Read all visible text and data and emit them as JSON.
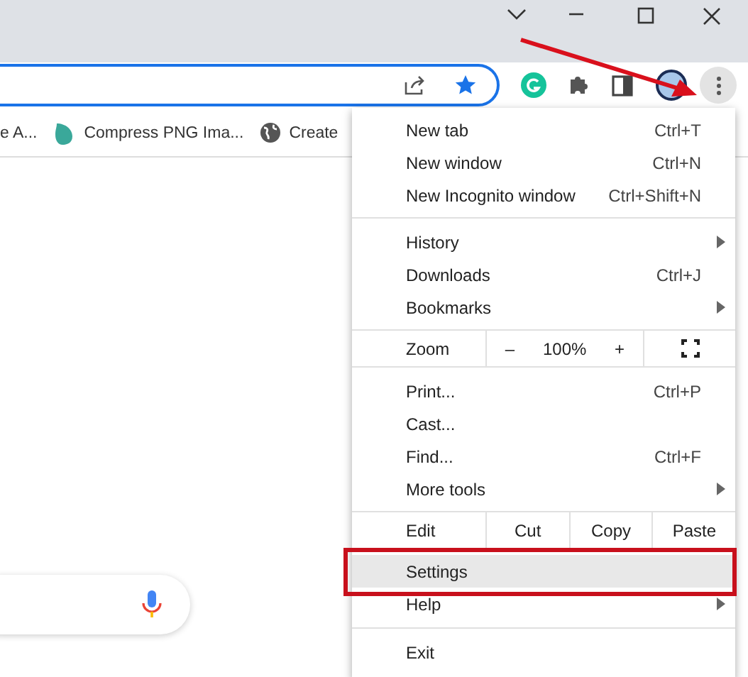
{
  "bookmarks": [
    {
      "label": "e A..."
    },
    {
      "label": "Compress PNG Ima..."
    },
    {
      "label": "Create"
    }
  ],
  "menu": {
    "sections": [
      {
        "items": [
          {
            "kind": "item",
            "label": "New tab",
            "shortcut": "Ctrl+T",
            "submenu": false,
            "selected": false
          },
          {
            "kind": "item",
            "label": "New window",
            "shortcut": "Ctrl+N",
            "submenu": false,
            "selected": false
          },
          {
            "kind": "item",
            "label": "New Incognito window",
            "shortcut": "Ctrl+Shift+N",
            "submenu": false,
            "selected": false
          }
        ]
      },
      {
        "items": [
          {
            "kind": "item",
            "label": "History",
            "submenu": true,
            "selected": false
          },
          {
            "kind": "item",
            "label": "Downloads",
            "shortcut": "Ctrl+J",
            "submenu": false,
            "selected": false
          },
          {
            "kind": "item",
            "label": "Bookmarks",
            "submenu": true,
            "selected": false
          }
        ]
      },
      {
        "items": [
          {
            "kind": "zoom",
            "label": "Zoom",
            "minus": "–",
            "value": "100%",
            "plus": "+"
          }
        ]
      },
      {
        "items": [
          {
            "kind": "item",
            "label": "Print...",
            "shortcut": "Ctrl+P",
            "submenu": false,
            "selected": false
          },
          {
            "kind": "item",
            "label": "Cast...",
            "submenu": false,
            "selected": false
          },
          {
            "kind": "item",
            "label": "Find...",
            "shortcut": "Ctrl+F",
            "submenu": false,
            "selected": false
          },
          {
            "kind": "item",
            "label": "More tools",
            "submenu": true,
            "selected": false
          }
        ]
      },
      {
        "items": [
          {
            "kind": "edit",
            "label": "Edit",
            "buttons": [
              "Cut",
              "Copy",
              "Paste"
            ]
          },
          {
            "kind": "item",
            "label": "Settings",
            "submenu": false,
            "selected": true
          },
          {
            "kind": "item",
            "label": "Help",
            "submenu": true,
            "selected": false
          }
        ]
      },
      {
        "items": [
          {
            "kind": "item",
            "label": "Exit",
            "submenu": false,
            "selected": false
          }
        ]
      }
    ]
  }
}
